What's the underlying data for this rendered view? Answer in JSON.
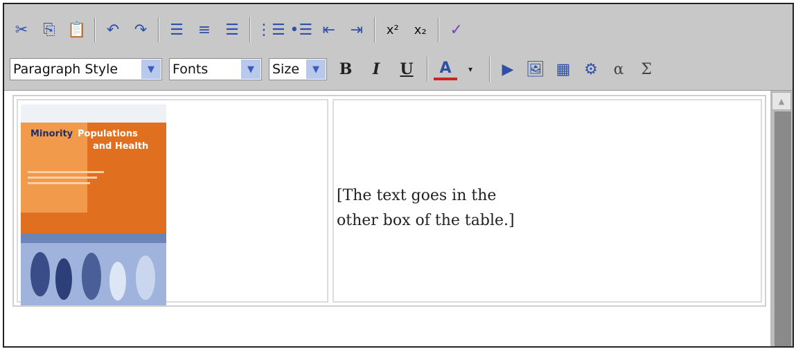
{
  "toolbar": {
    "row1": [
      {
        "name": "cut-icon",
        "glyph": "✂"
      },
      {
        "name": "copy-icon",
        "glyph": "⎘"
      },
      {
        "name": "paste-icon",
        "glyph": "📋"
      },
      {
        "name": "undo-icon",
        "glyph": "↶"
      },
      {
        "name": "redo-icon",
        "glyph": "↷"
      },
      {
        "name": "align-left-icon",
        "glyph": "☰"
      },
      {
        "name": "align-center-icon",
        "glyph": "≡"
      },
      {
        "name": "align-right-icon",
        "glyph": "☰"
      },
      {
        "name": "ordered-list-icon",
        "glyph": "⋮☰"
      },
      {
        "name": "unordered-list-icon",
        "glyph": "•☰"
      },
      {
        "name": "outdent-icon",
        "glyph": "⇤"
      },
      {
        "name": "indent-icon",
        "glyph": "⇥"
      },
      {
        "name": "superscript-icon",
        "glyph": "x²"
      },
      {
        "name": "subscript-icon",
        "glyph": "x₂"
      },
      {
        "name": "spellcheck-icon",
        "glyph": "✓"
      }
    ],
    "paragraph_style": "Paragraph Style",
    "fonts": "Fonts",
    "size": "Size",
    "bold": "B",
    "italic": "I",
    "underline": "U",
    "font_color": "A",
    "row2_icons": [
      {
        "name": "media-icon",
        "glyph": "▶"
      },
      {
        "name": "image-icon",
        "glyph": "🖼"
      },
      {
        "name": "table-icon",
        "glyph": "▦"
      },
      {
        "name": "special-object-icon",
        "glyph": "⚙"
      },
      {
        "name": "alpha-symbol-icon",
        "glyph": "α"
      },
      {
        "name": "sigma-symbol-icon",
        "glyph": "Σ"
      }
    ]
  },
  "cover": {
    "title_line1_a": "Minority",
    "title_line1_b": "Populations",
    "title_line2": "and Health"
  },
  "cell_text": {
    "line1": "[The text goes in the",
    "line2": "other box of the table.]"
  },
  "colors": {
    "toolbar_bg": "#c8c8c8",
    "icon_blue": "#2d4fa7",
    "font_color_underline": "#d02020",
    "cover_orange": "#e07020"
  }
}
